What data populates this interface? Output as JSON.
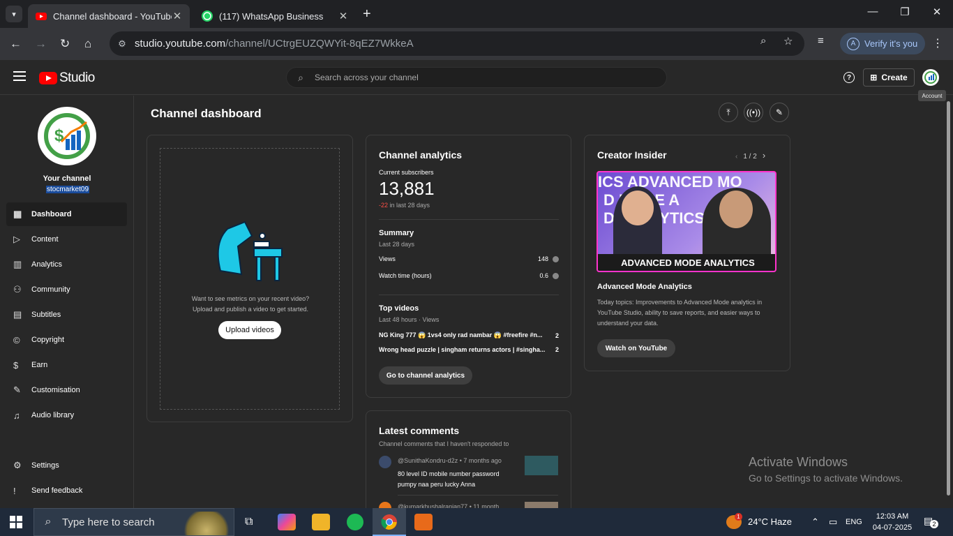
{
  "browser": {
    "tabs": [
      {
        "title": "Channel dashboard - YouTube S",
        "active": true
      },
      {
        "title": "(117) WhatsApp Business",
        "active": false
      }
    ],
    "url_host": "studio.youtube.com",
    "url_path": "/channel/UCtrgEUZQWYit-8qEZ7WkkeA",
    "verify_label": "Verify it's you",
    "verify_avatar": "A"
  },
  "header": {
    "logo_text": "Studio",
    "search_placeholder": "Search across your channel",
    "create_label": "Create",
    "account_tooltip": "Account"
  },
  "sidebar": {
    "your_channel": "Your channel",
    "handle": "stocmarket09",
    "items": [
      {
        "label": "Dashboard",
        "icon": "dashboard-icon"
      },
      {
        "label": "Content",
        "icon": "content-icon"
      },
      {
        "label": "Analytics",
        "icon": "analytics-icon"
      },
      {
        "label": "Community",
        "icon": "community-icon"
      },
      {
        "label": "Subtitles",
        "icon": "subtitles-icon"
      },
      {
        "label": "Copyright",
        "icon": "copyright-icon"
      },
      {
        "label": "Earn",
        "icon": "earn-icon"
      },
      {
        "label": "Customisation",
        "icon": "customisation-icon"
      },
      {
        "label": "Audio library",
        "icon": "audio-library-icon"
      }
    ],
    "bottom": [
      {
        "label": "Settings",
        "icon": "gear-icon"
      },
      {
        "label": "Send feedback",
        "icon": "feedback-icon"
      }
    ]
  },
  "main": {
    "title": "Channel dashboard",
    "upload_card": {
      "line1": "Want to see metrics on your recent video?",
      "line2": "Upload and publish a video to get started.",
      "button": "Upload videos"
    },
    "analytics": {
      "title": "Channel analytics",
      "subs_label": "Current subscribers",
      "subs_value": "13,881",
      "subs_change": "-22",
      "subs_change_suffix": " in last 28 days",
      "summary_title": "Summary",
      "summary_period": "Last 28 days",
      "views_label": "Views",
      "views_value": "148",
      "watch_label": "Watch time (hours)",
      "watch_value": "0.6",
      "top_title": "Top videos",
      "top_period": "Last 48 hours · Views",
      "top_videos": [
        {
          "title": "NG King 777 😱 1vs4 only rad nambar 😱 #freefire #n...",
          "views": "2"
        },
        {
          "title": "Wrong head puzzle | singham returns actors | #singha...",
          "views": "2"
        }
      ],
      "button": "Go to channel analytics"
    },
    "insider": {
      "title": "Creator Insider",
      "pager": "1 / 2",
      "thumb_top": "ICS ADVANCED MO",
      "thumb_mid1": "D MODE A",
      "thumb_mid2": "D ANALYTICS AD",
      "thumb_bottom": "ADVANCED MODE ANALYTICS",
      "video_title": "Advanced Mode Analytics",
      "description": "Today topics: Improvements to Advanced Mode analytics in YouTube Studio, ability to save reports, and easier ways to understand your data.",
      "button": "Watch on YouTube"
    },
    "comments": {
      "title": "Latest comments",
      "subtitle": "Channel comments that I haven't responded to",
      "items": [
        {
          "author": "@SunithaKondru-d2z",
          "time": "7 months ago",
          "line1": "80 level ID mobile number password",
          "line2": "pumpy naa peru lucky Anna"
        },
        {
          "author": "@kumarkhushalranjan77",
          "time": "11 month"
        }
      ]
    }
  },
  "watermark": {
    "line1": "Activate Windows",
    "line2": "Go to Settings to activate Windows."
  },
  "taskbar": {
    "search_placeholder": "Type here to search",
    "weather": "24°C  Haze",
    "weather_badge": "1",
    "lang": "ENG",
    "time": "12:03 AM",
    "date": "04-07-2025",
    "notif_count": "2"
  }
}
